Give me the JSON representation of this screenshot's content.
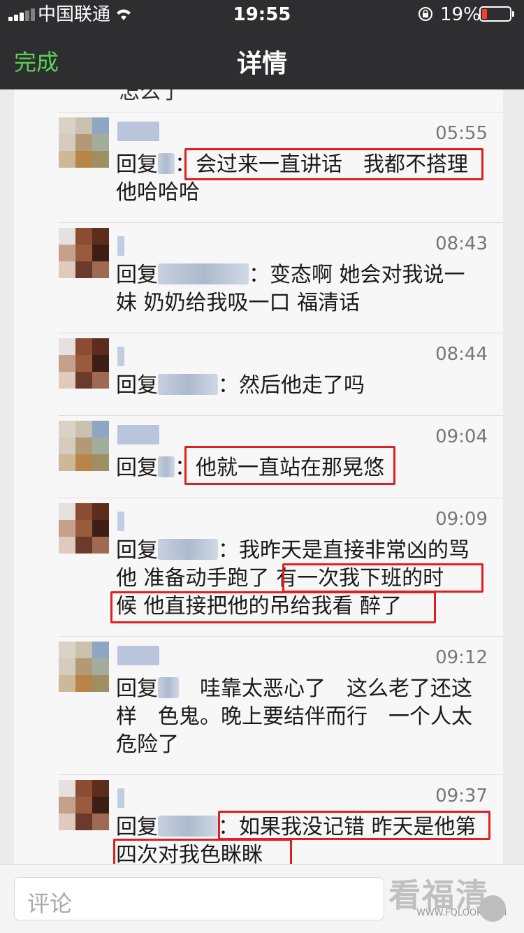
{
  "status_bar": {
    "carrier": "中国联通",
    "time": "19:55",
    "battery": "19%"
  },
  "nav": {
    "done_label": "完成",
    "title": "详情"
  },
  "cutoff_text": "怎么了",
  "comments": [
    {
      "time": "05:55",
      "reply_prefix": "回复",
      "lines": [
        "：会过来一直讲话　我都不搭理",
        "他哈哈哈"
      ]
    },
    {
      "time": "08:43",
      "reply_prefix": "回复",
      "lines": [
        "：变态啊 她会对我说一",
        "妹 奶奶给我吸一口 福清话"
      ]
    },
    {
      "time": "08:44",
      "reply_prefix": "回复",
      "lines": [
        "：然后他走了吗"
      ]
    },
    {
      "time": "09:04",
      "reply_prefix": "回复",
      "lines": [
        "：他就一直站在那晃悠"
      ]
    },
    {
      "time": "09:09",
      "reply_prefix": "回复",
      "lines": [
        "：我昨天是直接非常凶的骂",
        "他 准备动手跑了 有一次我下班的时",
        "候 他直接把他的吊给我看 醉了"
      ]
    },
    {
      "time": "09:12",
      "reply_prefix": "回复",
      "lines": [
        "　哇靠太恶心了　这么老了还这",
        "样　色鬼。晚上要结伴而行　一个人太",
        "危险了"
      ]
    },
    {
      "time": "09:37",
      "reply_prefix": "回复",
      "lines": [
        "：如果我没记错 昨天是他第",
        "四次对我色眯眯"
      ]
    }
  ],
  "input": {
    "placeholder": "评论"
  },
  "watermark": {
    "text": "看福清",
    "url": "WWW.FQLOOK.COM"
  },
  "colors": {
    "topbar": "#2e2e30",
    "done": "#5bd055",
    "highlight": "#e02020",
    "battery_low": "#ff3b30"
  },
  "icons": [
    "signal-icon",
    "wifi-icon",
    "rotation-lock-icon",
    "battery-icon"
  ]
}
